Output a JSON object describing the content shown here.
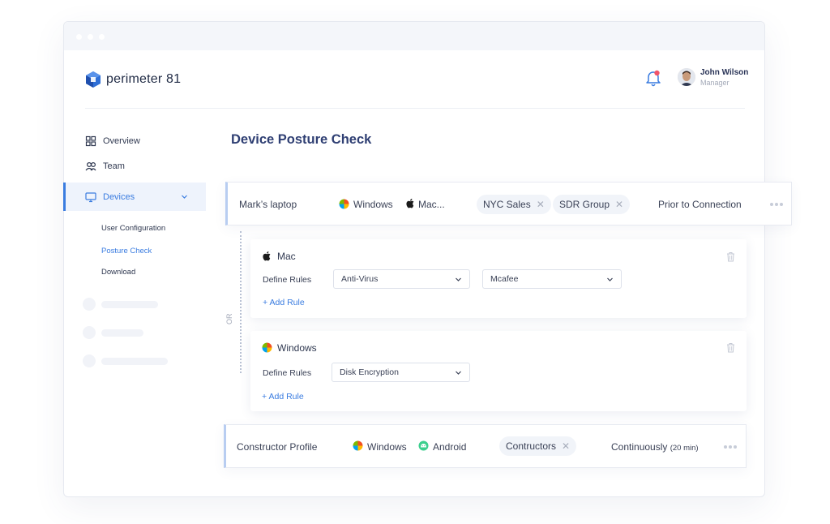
{
  "app": {
    "logo_text": "perimeter 81"
  },
  "user": {
    "name": "John Wilson",
    "role": "Manager"
  },
  "nav": {
    "overview": "Overview",
    "team": "Team",
    "devices": "Devices",
    "sub": [
      "User Configuration",
      "Posture Check",
      "Download"
    ]
  },
  "page": {
    "title": "Device Posture Check"
  },
  "profiles": [
    {
      "name": "Mark’s laptop",
      "os1": "Windows",
      "os2": "Mac...",
      "tags": [
        "NYC Sales",
        "SDR Group"
      ],
      "trigger": "Prior to Connection"
    },
    {
      "name": "Constructor Profile",
      "os1": "Windows",
      "os2": "Android",
      "tags": [
        "Contructors"
      ],
      "trigger": "Continuously",
      "trigger_note": "(20 min)"
    }
  ],
  "rules": {
    "mac": {
      "title": "Mac",
      "define_label": "Define Rules",
      "select1": "Anti-Virus",
      "select2": "Mcafee",
      "add_rule": "+ Add Rule"
    },
    "windows": {
      "title": "Windows",
      "define_label": "Define Rules",
      "select1": "Disk Encryption",
      "add_rule": "+ Add Rule"
    },
    "or_label": "OR"
  },
  "icons": {
    "brand": "hexagon-logo-icon",
    "notification": "bell-icon",
    "windows": "windows-logo-icon",
    "apple": "apple-logo-icon",
    "android": "android-logo-icon"
  },
  "colors": {
    "accent": "#3a7ce0",
    "title": "#2f3f73",
    "alert": "#f2546a"
  }
}
